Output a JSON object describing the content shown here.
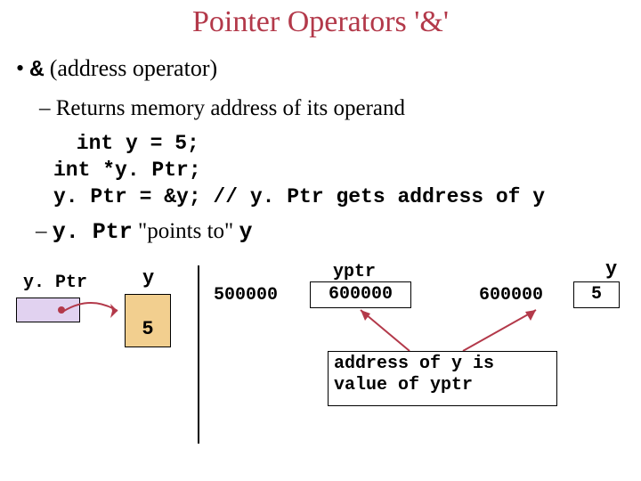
{
  "title": "Pointer Operators '&'",
  "bullets": {
    "level1": "& (address operator)",
    "level2a": "– Returns memory address of its operand",
    "level2b_prefix": "– ",
    "level2b_yptr": "y. Ptr",
    "level2b_mid": " \"points to\" ",
    "level2b_y": "y"
  },
  "code": {
    "l1": " int y = 5;",
    "l2": "int *y. Ptr;",
    "l3": "y. Ptr = &y; // y. Ptr gets address of y"
  },
  "left": {
    "yptr_label": "y. Ptr",
    "y_label": "y",
    "y_value": "5"
  },
  "right": {
    "addr_left": "500000",
    "yptr_label": "yptr",
    "yptr_value": "600000",
    "addr_mid": "600000",
    "y_label": "y",
    "y_value": "5",
    "note_l1": "address of y is",
    "note_l2": "value of yptr"
  }
}
